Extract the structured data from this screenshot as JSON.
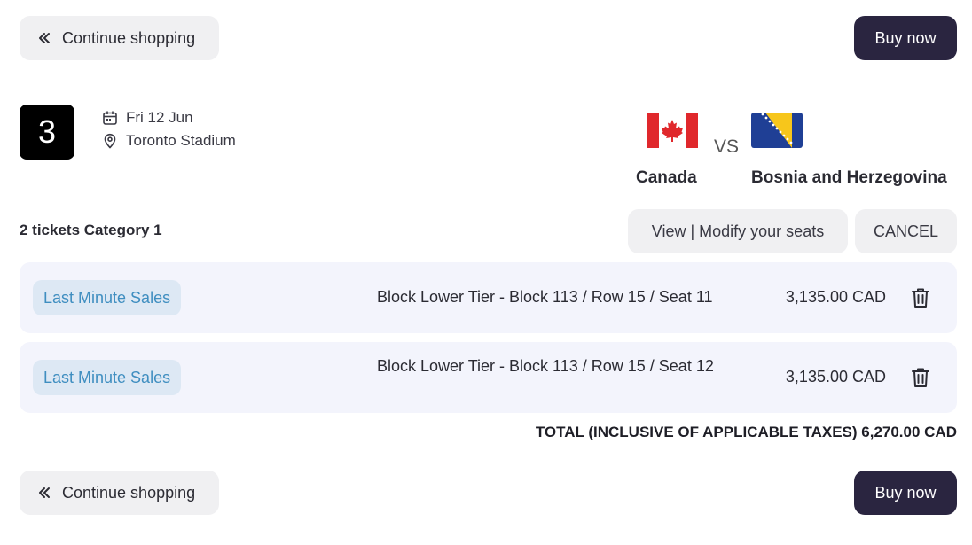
{
  "nav": {
    "continue_label": "Continue shopping",
    "continue_icon": "double-chevron-left-icon",
    "buy_label": "Buy now"
  },
  "match": {
    "number": "3",
    "date": "Fri 12 Jun",
    "venue": "Toronto Stadium",
    "home_team": "Canada",
    "away_team": "Bosnia and Herzegovina",
    "vs_label": "VS"
  },
  "tickets": {
    "summary": "2 tickets Category 1",
    "modify_label": "View | Modify your seats",
    "cancel_label": "CANCEL",
    "items": [
      {
        "badge": "Last Minute Sales",
        "seat": "Block Lower Tier - Block 113 / Row 15 / Seat 11",
        "price": "3,135.00 CAD"
      },
      {
        "badge": "Last Minute Sales",
        "seat": "Block Lower Tier - Block 113 / Row 15 / Seat 12",
        "price": "3,135.00 CAD"
      }
    ],
    "total": "TOTAL (INCLUSIVE OF APPLICABLE TAXES) 6,270.00 CAD"
  },
  "colors": {
    "buy_button": "#2a2540",
    "ticket_bg": "#f3f4fc",
    "badge_bg": "#dde8f4",
    "badge_text": "#3f8ec0"
  }
}
